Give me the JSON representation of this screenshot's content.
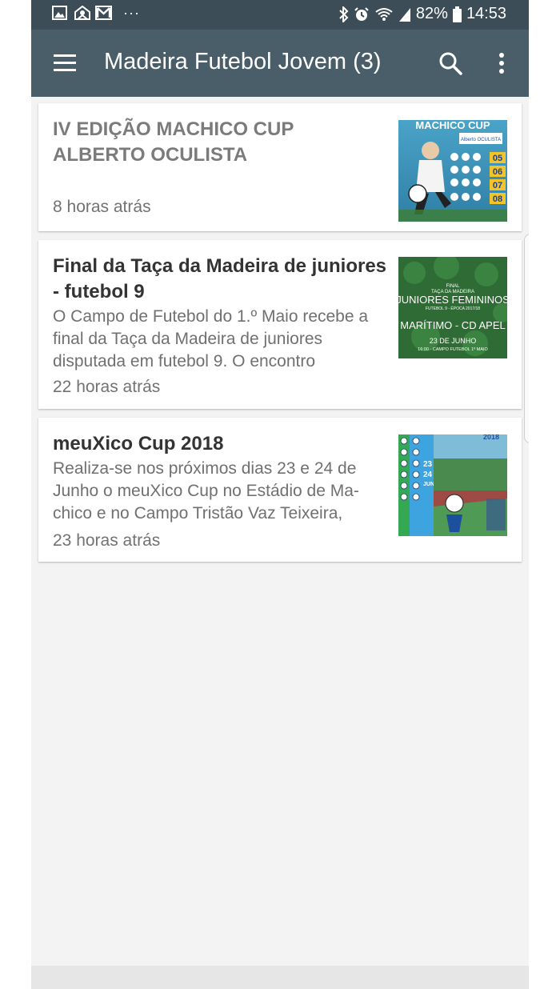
{
  "status_bar": {
    "notification_icons": [
      "gallery-icon",
      "inbox-icon",
      "gmail-icon"
    ],
    "more_dots": "···",
    "battery": "82%",
    "time": "14:53"
  },
  "appbar": {
    "title": "Madeira Futebol Jovem (3)",
    "menu_icon": "hamburger-menu-icon",
    "search_icon": "search-icon",
    "overflow_icon": "more-vert-icon",
    "color": "#4a5e69"
  },
  "articles": [
    {
      "title": "IV EDIÇÃO MACHICO CUP ALBERTO OCULISTA",
      "snippet": "",
      "time": "8 horas atrás",
      "read": true,
      "thumb_text": [
        "MACHICO CUP",
        "Alberto OCULISTA",
        "05",
        "06",
        "07",
        "08"
      ]
    },
    {
      "title": "Final da Taça da Madeira de juniores - futebol 9",
      "snippet": "O Campo de Futebol do 1.º Maio recebe a final da Taça da Madeira de juniores disputada em futebol 9. O encontro",
      "time": "22 horas atrás",
      "read": false,
      "thumb_text": [
        "FINAL",
        "TAÇA DA MADEIRA",
        "JUNIORES FEMININOS",
        "FUTEBOL 9 - ÉPOCA 2017/18",
        "MARÍTIMO - CD APEL",
        "23 DE JUNHO",
        "16:00 - CAMPO FUTEBOL 1º MAIO"
      ]
    },
    {
      "title": "meuXico Cup 2018",
      "snippet": "Realiza-se nos próximos dias 23 e 24 de Junho o meuXico Cup no Estádio de Ma-chico e no Campo Tristão Vaz Teixeira,",
      "time": "23 horas atrás",
      "read": false,
      "thumb_text": [
        "2018",
        "23",
        "24",
        "JUN"
      ]
    }
  ]
}
